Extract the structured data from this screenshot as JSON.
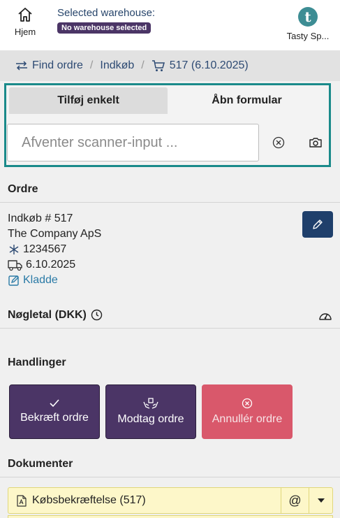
{
  "topbar": {
    "home_label": "Hjem",
    "warehouse_label": "Selected warehouse:",
    "warehouse_badge": "No warehouse selected",
    "company_initial": "t",
    "company_label": "Tasty Sp..."
  },
  "breadcrumb": {
    "items": [
      "Find ordre",
      "Indkøb",
      "517 (6.10.2025)"
    ]
  },
  "scanner": {
    "tabs": [
      "Tilføj enkelt",
      "Åbn formular"
    ],
    "placeholder": "Afventer scanner-input ..."
  },
  "order": {
    "heading": "Ordre",
    "title": "Indkøb # 517",
    "company": "The Company ApS",
    "reference": "1234567",
    "date": "6.10.2025",
    "status": "Kladde"
  },
  "keyfigures": {
    "heading": "Nøgletal (DKK)"
  },
  "actions": {
    "heading": "Handlinger",
    "confirm": "Bekræft ordre",
    "receive": "Modtag ordre",
    "cancel": "Annullér ordre"
  },
  "documents": {
    "heading": "Dokumenter",
    "items": [
      "Købsbekræftelse (517)"
    ],
    "at_symbol": "@"
  },
  "colors": {
    "accent_teal": "#1a8a8a",
    "purple": "#4b3566",
    "navy": "#1f3f6b",
    "red": "#d9586b"
  }
}
